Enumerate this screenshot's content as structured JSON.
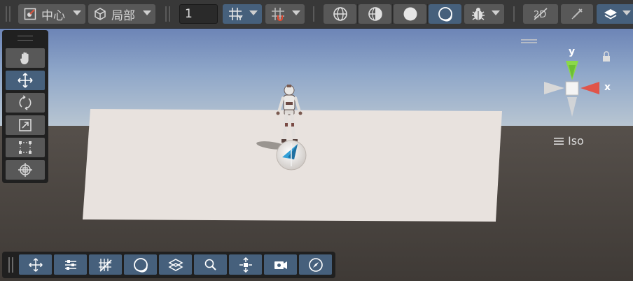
{
  "toolbar": {
    "pivot_mode_label": "中心",
    "pivot_rotation_label": "局部",
    "grid_size_value": "1"
  },
  "gizmo": {
    "projection_label": "Iso",
    "y_axis": "y",
    "x_axis": "x"
  },
  "colors": {
    "active": "#46607c",
    "button": "#585858",
    "toolbar_bg": "#383838",
    "sky_top": "#7189b9",
    "ground": "#47423d",
    "plane": "#e6e0dc",
    "x_axis": "#d9534a",
    "y_axis": "#87d04a"
  },
  "icons": {
    "tools": [
      "hand-icon",
      "move-icon",
      "rotate-icon",
      "scale-icon",
      "rect-transform-icon",
      "transform-icon"
    ],
    "overlays": [
      "move-tool-icon",
      "tool-settings-icon",
      "grid-snapping-icon",
      "view-options-icon",
      "orientation-icon",
      "search-icon",
      "component-tools-icon",
      "camera-icon",
      "navigate-icon"
    ]
  }
}
